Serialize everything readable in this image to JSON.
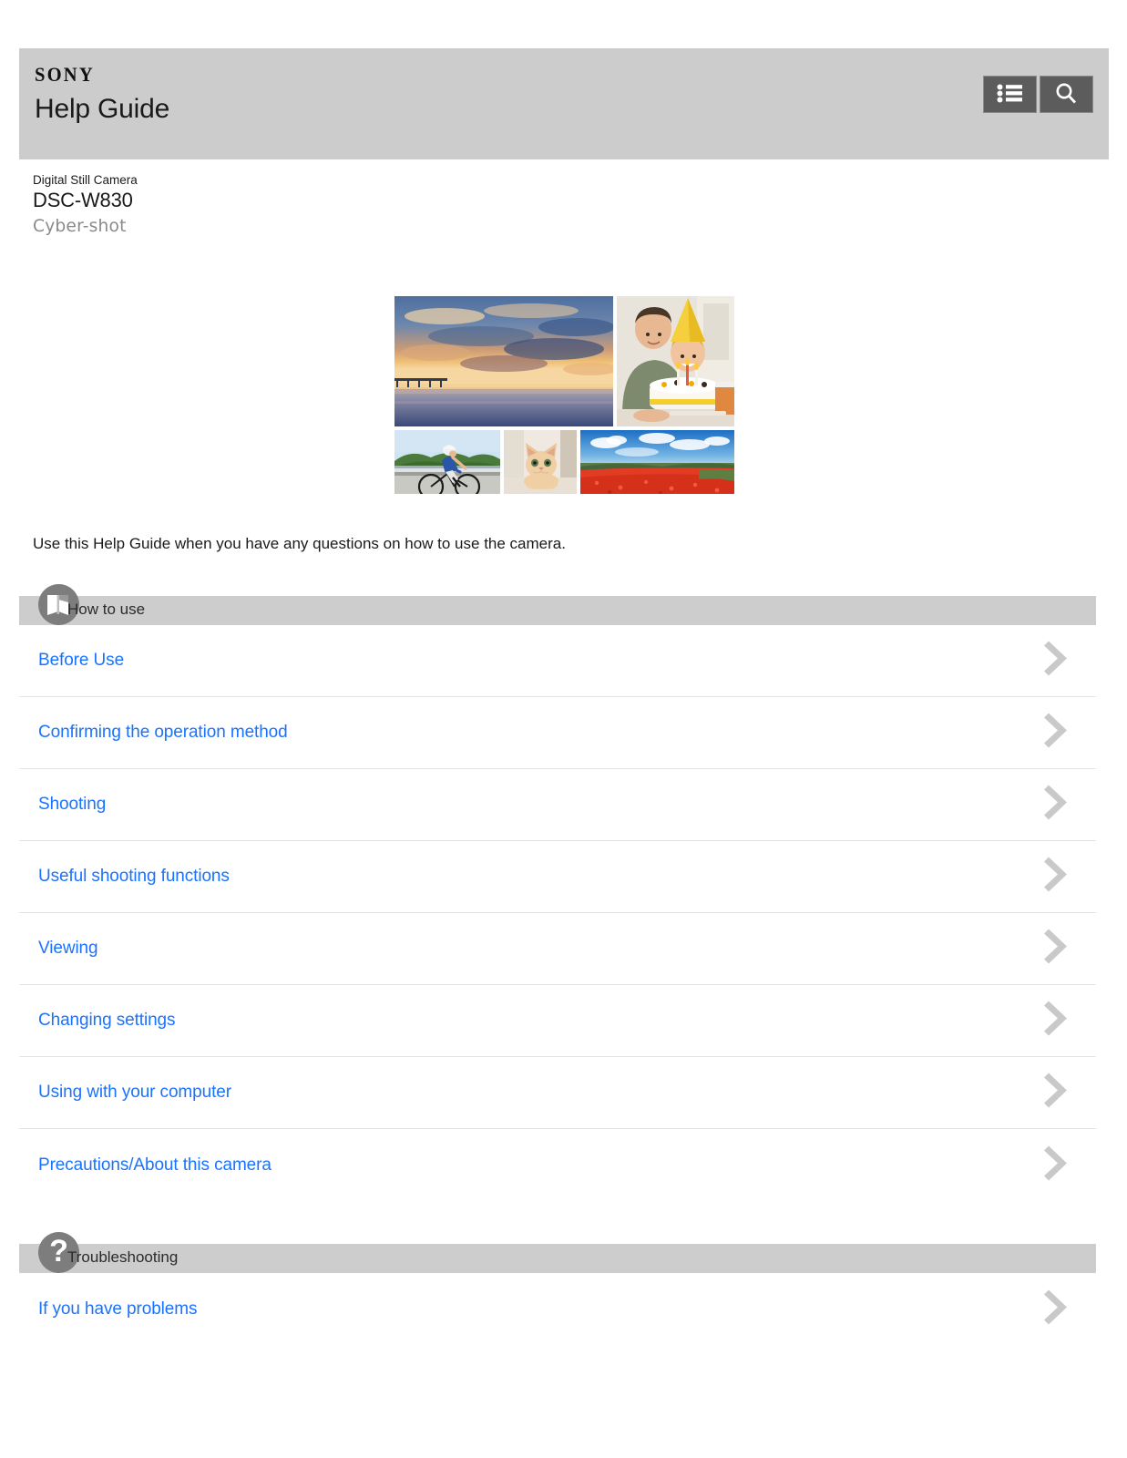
{
  "header": {
    "brand": "SONY",
    "title": "Help Guide",
    "menu_button_label": "Menu",
    "menu_icon": "list-menu-icon",
    "search_button_label": "Search",
    "search_icon": "search-icon",
    "background_color": "#cccccc",
    "button_color": "#5c5c5c"
  },
  "product": {
    "kind": "Digital Still Camera",
    "model": "DSC-W830",
    "brand_line": "Cyber-shot"
  },
  "collage": {
    "tiles": [
      {
        "name": "sunset-beach-pier",
        "alt": "Sunset over the sea with a pier"
      },
      {
        "name": "father-and-child-birthday-cake",
        "alt": "Father and child with birthday cake"
      },
      {
        "name": "road-cyclist",
        "alt": "Cyclist riding on a coastal road"
      },
      {
        "name": "cat-peeking",
        "alt": "Ginger cat lying indoors"
      },
      {
        "name": "red-poppy-field",
        "alt": "Field of red poppies under blue sky"
      }
    ]
  },
  "intro": {
    "text": "Use this Help Guide when you have any questions on how to use the camera."
  },
  "sections": [
    {
      "id": "how-to-use",
      "label": "How to use",
      "badge_icon": "manual-book-icon",
      "items": [
        {
          "label": "Before Use"
        },
        {
          "label": "Confirming the operation method"
        },
        {
          "label": "Shooting"
        },
        {
          "label": "Useful shooting functions"
        },
        {
          "label": "Viewing"
        },
        {
          "label": "Changing settings"
        },
        {
          "label": "Using with your computer"
        },
        {
          "label": "Precautions/About this camera"
        }
      ]
    },
    {
      "id": "troubleshooting",
      "label": "Troubleshooting",
      "badge_icon": "question-mark-icon",
      "badge_glyph": "?",
      "items": [
        {
          "label": "If you have problems"
        }
      ]
    }
  ],
  "colors": {
    "link": "#1a73ff",
    "section_bar": "#cdcdcd",
    "badge": "#7d7d7d",
    "chevron": "#c9c9c9",
    "divider": "#e2e2e2"
  }
}
